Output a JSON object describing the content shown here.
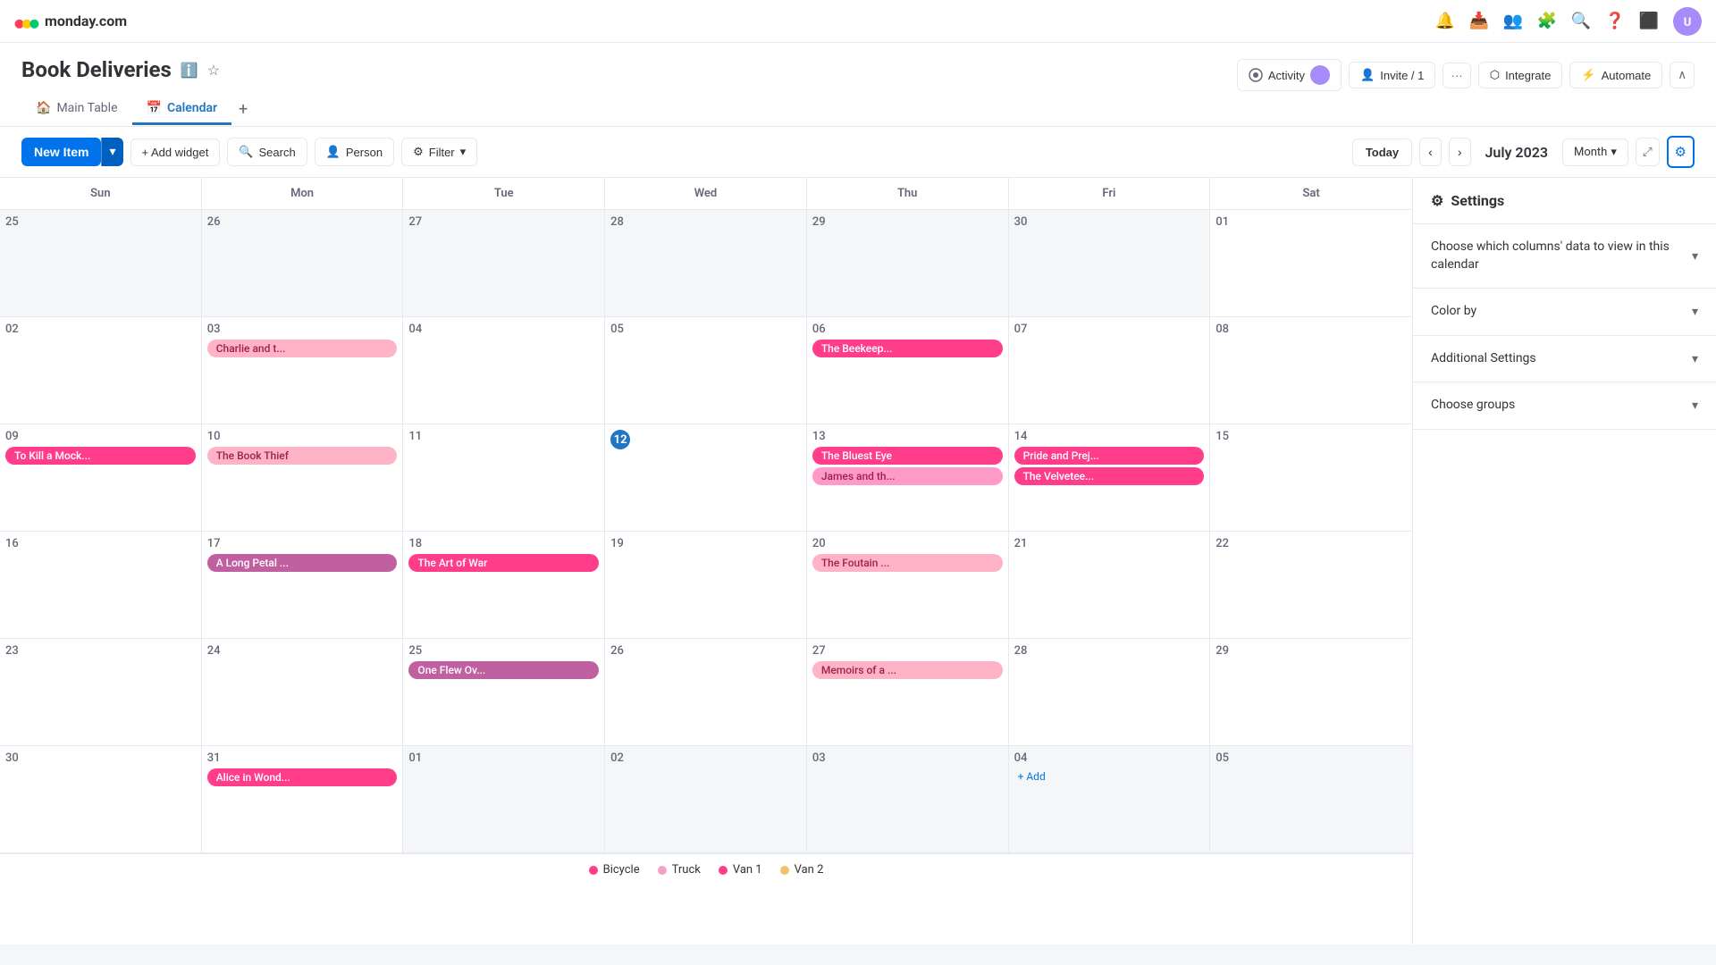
{
  "app": {
    "name": "monday.com"
  },
  "topnav": {
    "icons": [
      "bell",
      "inbox",
      "people",
      "puzzle",
      "search",
      "help",
      "apps"
    ]
  },
  "page": {
    "title": "Book Deliveries",
    "info_icon": "ℹ",
    "star_icon": "☆"
  },
  "header": {
    "activity_label": "Activity",
    "invite_label": "Invite / 1",
    "more_label": "···"
  },
  "tabs": [
    {
      "label": "Main Table",
      "active": false
    },
    {
      "label": "Calendar",
      "active": true
    }
  ],
  "toolbar": {
    "new_item": "New Item",
    "add_widget": "+ Add widget",
    "search": "Search",
    "person": "Person",
    "filter": "Filter",
    "today": "Today",
    "current_month": "July 2023",
    "month_view": "Month",
    "settings_icon": "⚙"
  },
  "calendar": {
    "days": [
      "Sun",
      "Mon",
      "Tue",
      "Wed",
      "Thu",
      "Fri",
      "Sat"
    ],
    "weeks": [
      [
        {
          "num": "25",
          "outside": true,
          "events": []
        },
        {
          "num": "26",
          "outside": true,
          "events": []
        },
        {
          "num": "27",
          "outside": true,
          "events": []
        },
        {
          "num": "28",
          "outside": true,
          "events": []
        },
        {
          "num": "29",
          "outside": true,
          "events": []
        },
        {
          "num": "30",
          "outside": true,
          "events": []
        },
        {
          "num": "01",
          "outside": false,
          "events": []
        }
      ],
      [
        {
          "num": "02",
          "outside": false,
          "events": []
        },
        {
          "num": "03",
          "outside": false,
          "events": [
            {
              "label": "Charlie and t...",
              "color": "#ffb3c6",
              "textColor": "#9e2050"
            }
          ]
        },
        {
          "num": "04",
          "outside": false,
          "events": []
        },
        {
          "num": "05",
          "outside": false,
          "events": []
        },
        {
          "num": "06",
          "outside": false,
          "events": [
            {
              "label": "The Beekeep...",
              "color": "#ff3d8b",
              "textColor": "#fff"
            }
          ]
        },
        {
          "num": "07",
          "outside": false,
          "events": []
        },
        {
          "num": "08",
          "outside": false,
          "events": []
        }
      ],
      [
        {
          "num": "09",
          "outside": false,
          "events": [
            {
              "label": "To Kill a Mock...",
              "color": "#ff3d8b",
              "textColor": "#fff"
            }
          ]
        },
        {
          "num": "10",
          "outside": false,
          "events": [
            {
              "label": "The Book Thief",
              "color": "#ffb3c6",
              "textColor": "#9e2050"
            }
          ]
        },
        {
          "num": "11",
          "outside": false,
          "events": []
        },
        {
          "num": "12",
          "outside": false,
          "today": true,
          "events": []
        },
        {
          "num": "13",
          "outside": false,
          "events": [
            {
              "label": "The Bluest Eye",
              "color": "#ff3d8b",
              "textColor": "#fff"
            },
            {
              "label": "James and th...",
              "color": "#ff99c8",
              "textColor": "#9e2050"
            }
          ]
        },
        {
          "num": "14",
          "outside": false,
          "events": [
            {
              "label": "Pride and Prej...",
              "color": "#ff3d8b",
              "textColor": "#fff"
            },
            {
              "label": "The Velvetee...",
              "color": "#ff3d8b",
              "textColor": "#fff"
            }
          ]
        },
        {
          "num": "15",
          "outside": false,
          "events": []
        }
      ],
      [
        {
          "num": "16",
          "outside": false,
          "events": []
        },
        {
          "num": "17",
          "outside": false,
          "events": [
            {
              "label": "A Long Petal ...",
              "color": "#c060a1",
              "textColor": "#fff"
            }
          ]
        },
        {
          "num": "18",
          "outside": false,
          "events": [
            {
              "label": "The Art of War",
              "color": "#ff3d8b",
              "textColor": "#fff"
            }
          ]
        },
        {
          "num": "19",
          "outside": false,
          "events": []
        },
        {
          "num": "20",
          "outside": false,
          "events": [
            {
              "label": "The Foutain ...",
              "color": "#ffb3c6",
              "textColor": "#9e2050"
            }
          ]
        },
        {
          "num": "21",
          "outside": false,
          "events": []
        },
        {
          "num": "22",
          "outside": false,
          "events": []
        }
      ],
      [
        {
          "num": "23",
          "outside": false,
          "events": []
        },
        {
          "num": "24",
          "outside": false,
          "events": []
        },
        {
          "num": "25",
          "outside": false,
          "events": [
            {
              "label": "One Flew Ov...",
              "color": "#c060a1",
              "textColor": "#fff"
            }
          ]
        },
        {
          "num": "26",
          "outside": false,
          "events": []
        },
        {
          "num": "27",
          "outside": false,
          "events": [
            {
              "label": "Memoirs of a ...",
              "color": "#ffb3c6",
              "textColor": "#9e2050"
            }
          ]
        },
        {
          "num": "28",
          "outside": false,
          "events": []
        },
        {
          "num": "29",
          "outside": false,
          "events": []
        }
      ],
      [
        {
          "num": "30",
          "outside": false,
          "events": []
        },
        {
          "num": "31",
          "outside": false,
          "events": [
            {
              "label": "Alice in Wond...",
              "color": "#ff3d8b",
              "textColor": "#fff"
            }
          ]
        },
        {
          "num": "01",
          "outside": true,
          "events": []
        },
        {
          "num": "02",
          "outside": true,
          "events": []
        },
        {
          "num": "03",
          "outside": true,
          "events": []
        },
        {
          "num": "04",
          "outside": true,
          "events": [],
          "addBtn": true
        },
        {
          "num": "05",
          "outside": true,
          "events": []
        }
      ]
    ]
  },
  "settings": {
    "title": "Settings",
    "columns_label": "Choose which columns' data to view in this calendar",
    "color_by_label": "Color by",
    "additional_settings_label": "Additional Settings",
    "choose_groups_label": "Choose groups"
  },
  "legend": [
    {
      "label": "Bicycle",
      "color": "#ff3d8b"
    },
    {
      "label": "Truck",
      "color": "#f5a0c8"
    },
    {
      "label": "Van 1",
      "color": "#ff3d8b"
    },
    {
      "label": "Van 2",
      "color": "#f5c06e"
    }
  ]
}
